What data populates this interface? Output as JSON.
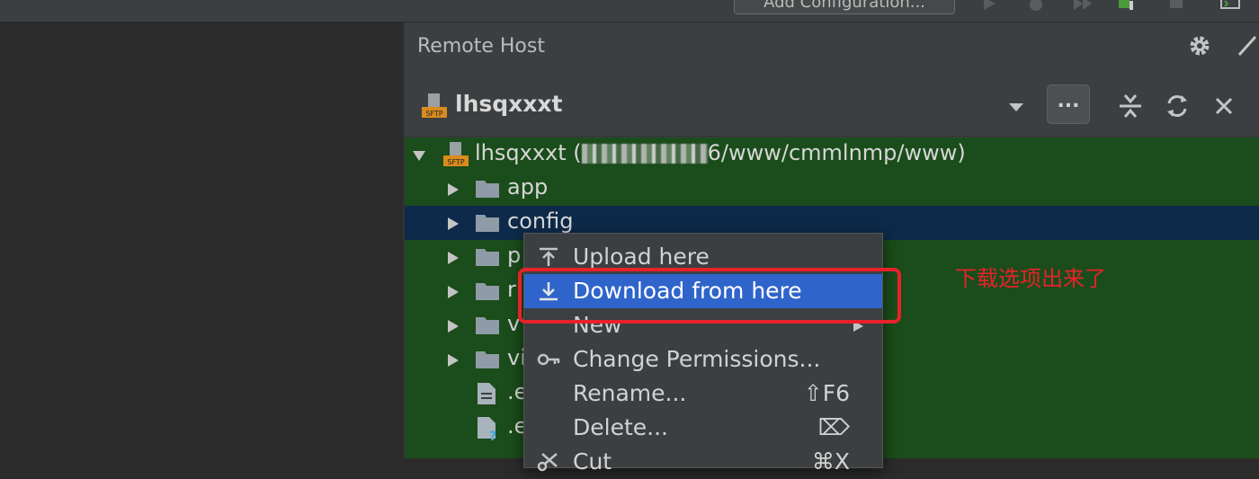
{
  "top_toolbar": {
    "add_configuration_label": "Add Configuration...",
    "icons": [
      "run-icon",
      "debug-icon",
      "coverage-icon",
      "build-icon",
      "stop-icon",
      "terminal-icon"
    ]
  },
  "panel": {
    "title": "Remote Host",
    "settings_icon": "gear-icon"
  },
  "server_bar": {
    "server_name": "lhsqxxxt",
    "server_icon": "sftp-icon",
    "more_label": "...",
    "icons": [
      "dropdown-icon",
      "collapse-all-icon",
      "refresh-icon",
      "close-icon"
    ]
  },
  "tree": {
    "root": {
      "name": "lhsqxxxt (",
      "path_suffix": "6/www/cmmlnmp/www)"
    },
    "items": [
      {
        "label": "app",
        "type": "folder"
      },
      {
        "label": "config",
        "type": "folder",
        "selected": true
      },
      {
        "label": "p",
        "type": "folder"
      },
      {
        "label": "r",
        "type": "folder"
      },
      {
        "label": "v",
        "type": "folder"
      },
      {
        "label": "vi",
        "type": "folder"
      },
      {
        "label": ".e",
        "type": "file"
      },
      {
        "label": ".e",
        "type": "unknown-file"
      }
    ]
  },
  "context_menu": {
    "items": [
      {
        "label": "Upload here",
        "icon": "upload-icon",
        "shortcut": ""
      },
      {
        "label": "Download from here",
        "icon": "download-icon",
        "shortcut": "",
        "active": true
      },
      {
        "label": "New",
        "icon": "",
        "shortcut": "",
        "submenu": true
      },
      {
        "label": "Change Permissions...",
        "icon": "key-icon",
        "shortcut": ""
      },
      {
        "label": "Rename...",
        "icon": "",
        "shortcut": "⇧F6"
      },
      {
        "label": "Delete...",
        "icon": "",
        "shortcut": "⌦"
      },
      {
        "label": "Cut",
        "icon": "scissors-icon",
        "shortcut": "⌘X"
      }
    ]
  },
  "annotation": {
    "text": "下载选项出来了",
    "color": "#e8222a"
  },
  "colors": {
    "tree_background": "#1b4c1b",
    "selected_row": "#0d2a4a",
    "menu_active": "#2f65ca",
    "panel_background": "#3c3f41"
  }
}
